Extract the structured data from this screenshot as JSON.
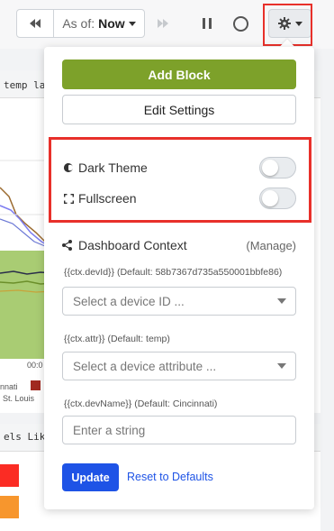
{
  "toolbar": {
    "as_of_label": "As of:",
    "as_of_value": "Now",
    "icons": [
      "rewind-icon",
      "chevron-down-icon",
      "fast-forward-icon",
      "pause-icon",
      "refresh-icon",
      "gear-icon"
    ]
  },
  "background": {
    "widget1_title": "temp la",
    "widget2_title": "els Lik",
    "time_label": "00:0",
    "legend_left": "nnati",
    "legend_right": "St. Louis",
    "swatch_colors": [
      "#fb2c24",
      "#f7962d"
    ]
  },
  "menu": {
    "add_block": "Add Block",
    "edit_settings": "Edit Settings",
    "dark_theme": {
      "label": "Dark Theme",
      "on": false
    },
    "fullscreen": {
      "label": "Fullscreen",
      "on": false
    },
    "context_title": "Dashboard Context",
    "manage": "(Manage)",
    "devid": {
      "label": "{{ctx.devId}} (Default: 58b7367d735a550001bbfe86)",
      "placeholder": "Select a device ID ..."
    },
    "attr": {
      "label": "{{ctx.attr}} (Default: temp)",
      "placeholder": "Select a device attribute ..."
    },
    "devname": {
      "label": "{{ctx.devName}} (Default: Cincinnati)",
      "placeholder": "Enter a string"
    },
    "update": "Update",
    "reset": "Reset to Defaults"
  },
  "colors": {
    "accent_green": "#7da12a",
    "primary_blue": "#1e53e6",
    "highlight_red": "#e8302a"
  }
}
